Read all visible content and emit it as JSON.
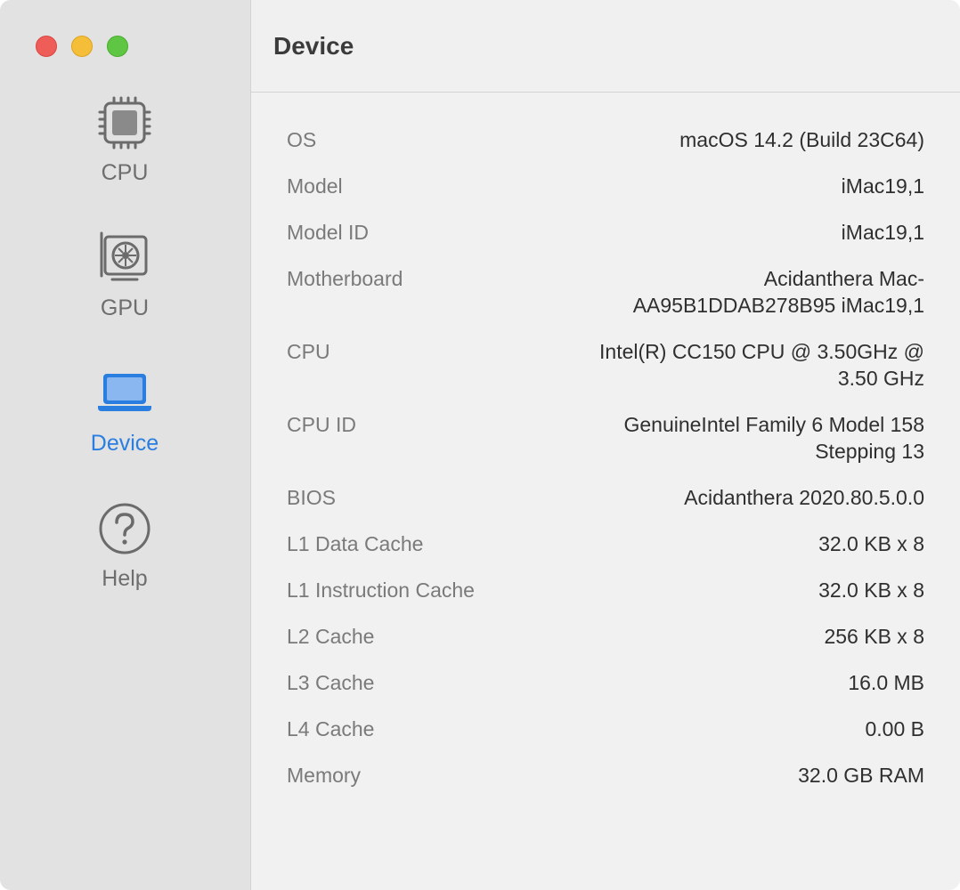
{
  "sidebar": {
    "items": [
      {
        "label": "CPU",
        "icon": "cpu-chip-icon"
      },
      {
        "label": "GPU",
        "icon": "graphics-card-icon"
      },
      {
        "label": "Device",
        "icon": "laptop-icon",
        "active": true
      },
      {
        "label": "Help",
        "icon": "question-circle-icon"
      }
    ]
  },
  "colors": {
    "accent": "#2a7ee0",
    "sidebar_bg": "#e2e2e2",
    "main_bg": "#f1f1f1"
  },
  "header": {
    "title": "Device"
  },
  "device": {
    "rows": [
      {
        "key": "OS",
        "value": "macOS 14.2 (Build 23C64)"
      },
      {
        "key": "Model",
        "value": "iMac19,1"
      },
      {
        "key": "Model ID",
        "value": "iMac19,1"
      },
      {
        "key": "Motherboard",
        "value": "Acidanthera Mac-\nAA95B1DDAB278B95 iMac19,1"
      },
      {
        "key": "CPU",
        "value": "Intel(R) CC150 CPU @ 3.50GHz @\n3.50 GHz"
      },
      {
        "key": "CPU ID",
        "value": "GenuineIntel Family 6 Model 158\nStepping 13"
      },
      {
        "key": "BIOS",
        "value": "Acidanthera 2020.80.5.0.0"
      },
      {
        "key": "L1 Data Cache",
        "value": "32.0 KB x 8"
      },
      {
        "key": "L1 Instruction Cache",
        "value": "32.0 KB x 8"
      },
      {
        "key": "L2 Cache",
        "value": "256 KB x 8"
      },
      {
        "key": "L3 Cache",
        "value": "16.0 MB"
      },
      {
        "key": "L4 Cache",
        "value": "0.00 B"
      },
      {
        "key": "Memory",
        "value": "32.0 GB RAM"
      }
    ]
  }
}
